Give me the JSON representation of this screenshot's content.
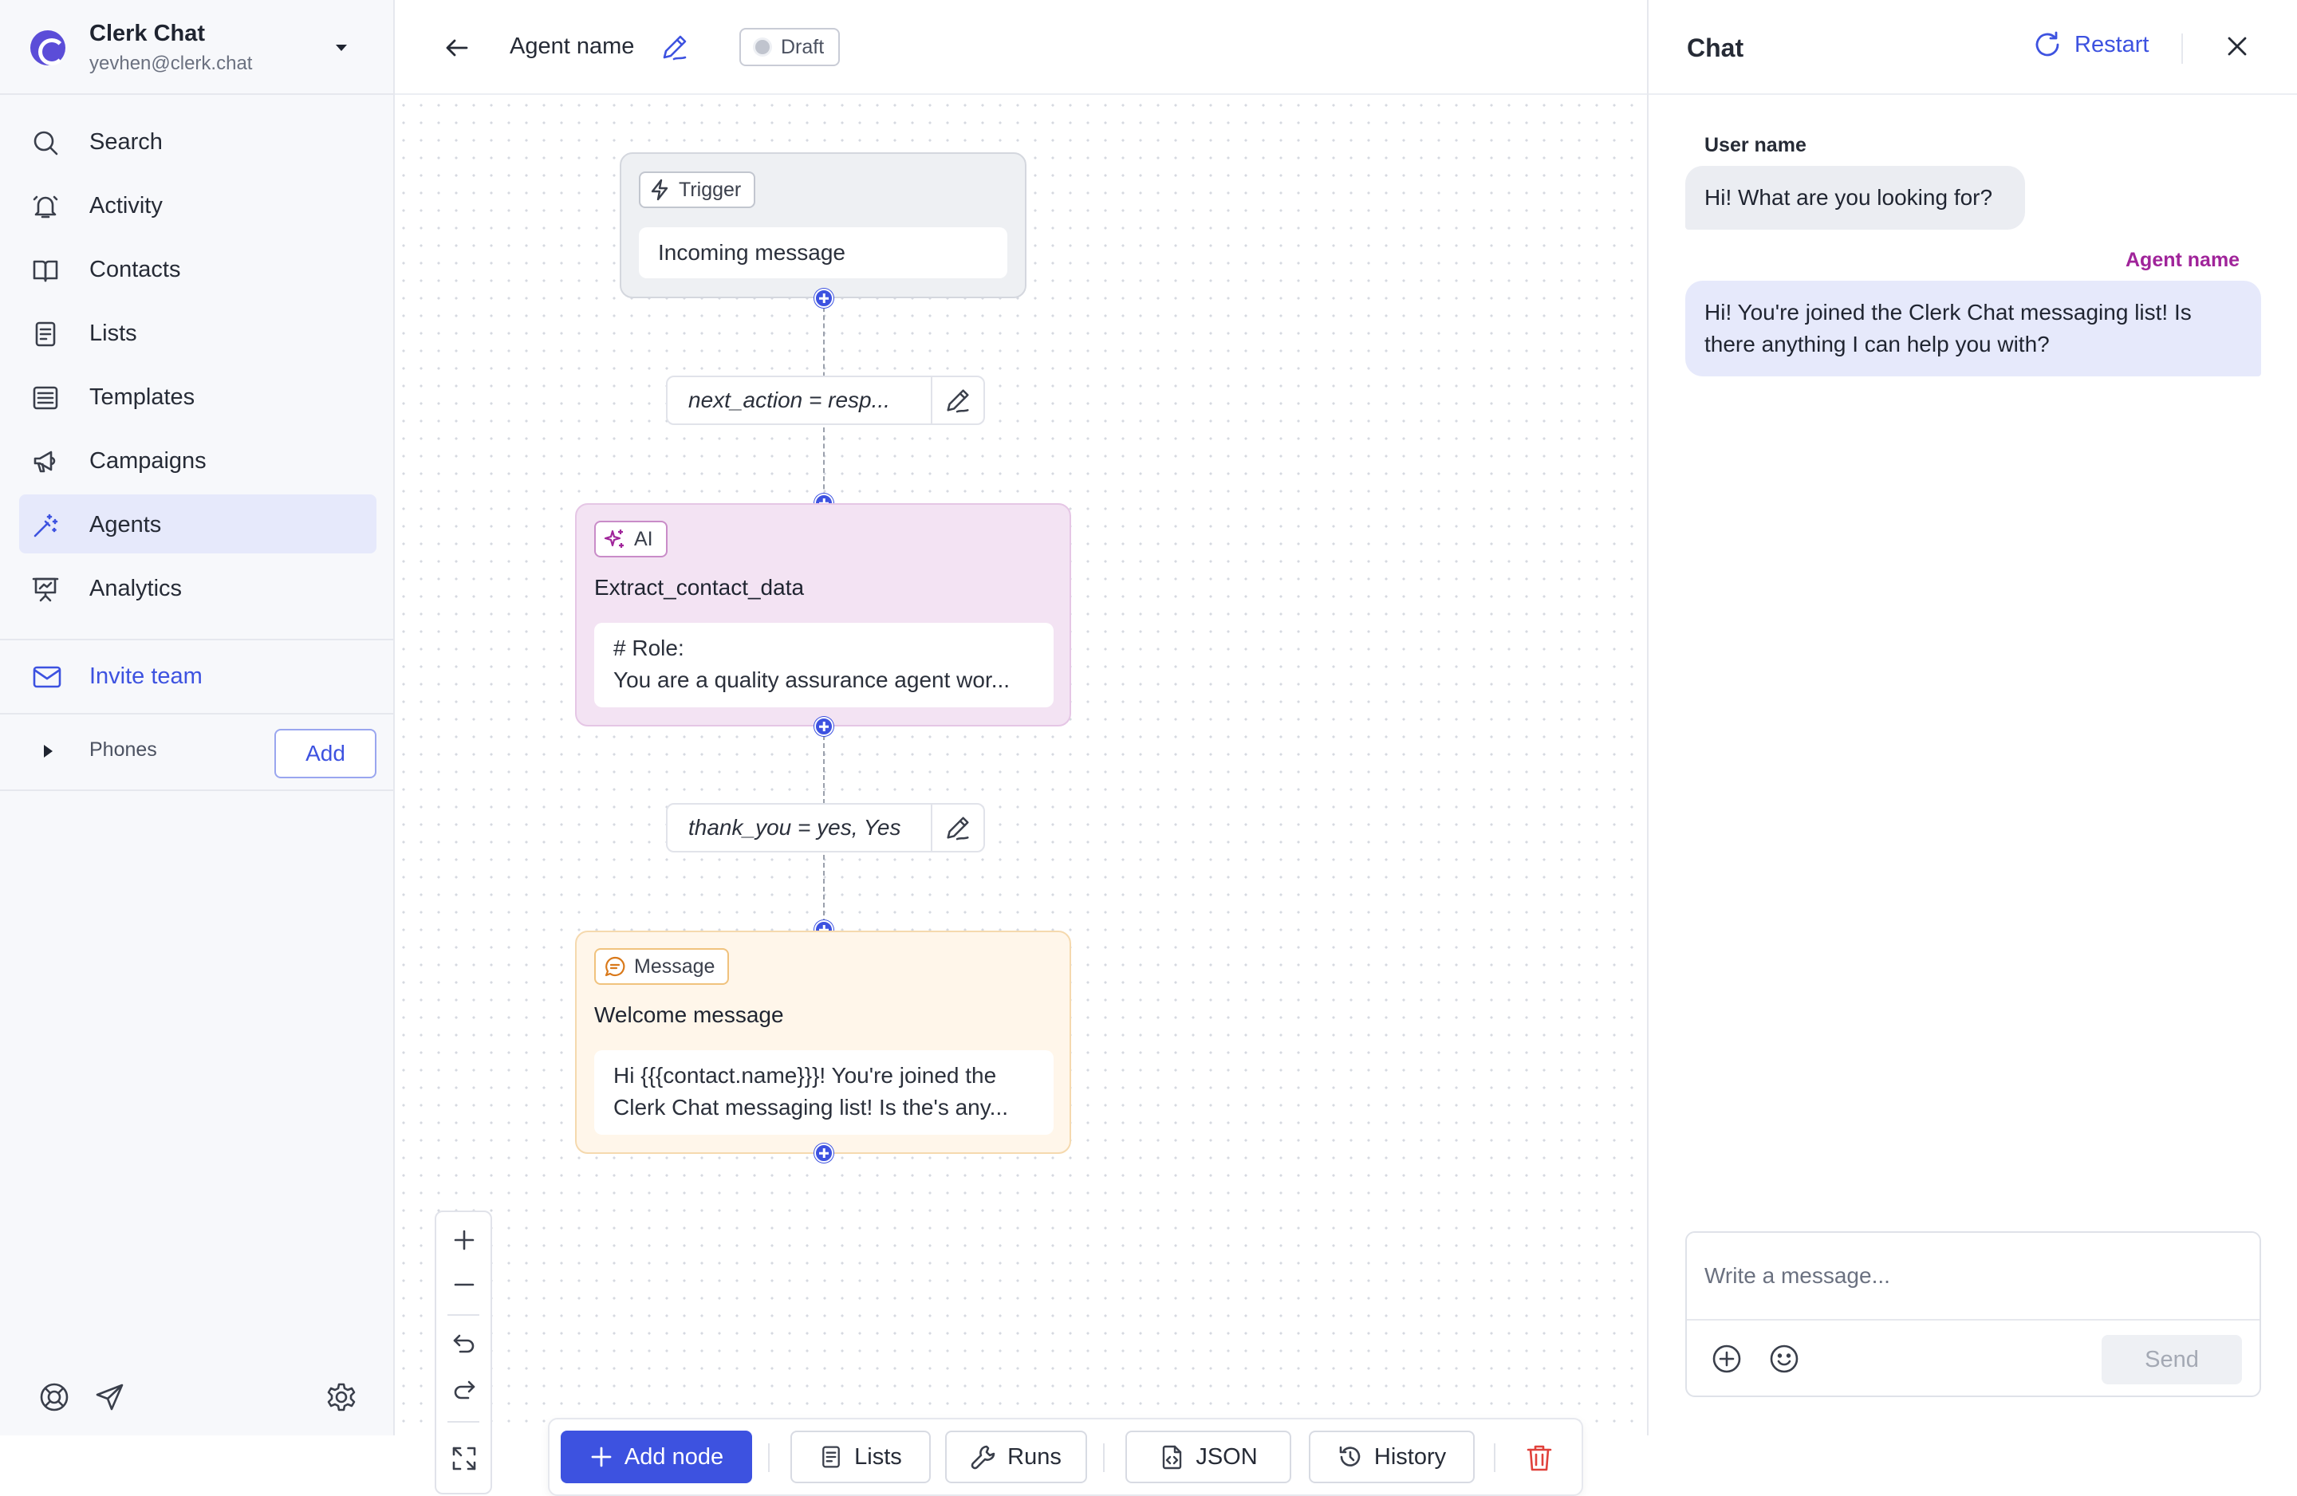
{
  "workspace": {
    "name": "Clerk Chat",
    "email": "yevhen@clerk.chat"
  },
  "nav": [
    {
      "label": "Search",
      "icon": "search-icon",
      "active": false
    },
    {
      "label": "Activity",
      "icon": "bell-icon",
      "active": false
    },
    {
      "label": "Contacts",
      "icon": "book-icon",
      "active": false
    },
    {
      "label": "Lists",
      "icon": "document-icon",
      "active": false
    },
    {
      "label": "Templates",
      "icon": "template-icon",
      "active": false
    },
    {
      "label": "Campaigns",
      "icon": "megaphone-icon",
      "active": false
    },
    {
      "label": "Agents",
      "icon": "magic-wand-icon",
      "active": true
    },
    {
      "label": "Analytics",
      "icon": "presentation-chart-icon",
      "active": false
    }
  ],
  "invite": {
    "label": "Invite team"
  },
  "phones": {
    "label": "Phones",
    "add_label": "Add"
  },
  "header": {
    "agent_name": "Agent name",
    "status": "Draft"
  },
  "flow": {
    "trigger": {
      "badge": "Trigger",
      "body": "Incoming message"
    },
    "condition1": {
      "text": "next_action = resp..."
    },
    "ai": {
      "badge": "AI",
      "title": "Extract_contact_data",
      "line1": "# Role:",
      "line2": "You are a quality assurance agent wor..."
    },
    "condition2": {
      "text": "thank_you = yes, Yes"
    },
    "message": {
      "badge": "Message",
      "title": "Welcome message",
      "line1": "Hi {{{contact.name}}}! You're joined the",
      "line2": "Clerk Chat messaging list! Is the's any..."
    }
  },
  "toolbar": {
    "add_node": "Add node",
    "lists": "Lists",
    "runs": "Runs",
    "json": "JSON",
    "history": "History"
  },
  "chat": {
    "title": "Chat",
    "restart": "Restart",
    "messages": [
      {
        "sender": "User name",
        "text": "Hi! What are you looking for?"
      },
      {
        "sender": "Agent name",
        "line1": "Hi! You're joined the Clerk Chat messaging list! Is",
        "line2": "there anything I can help you with?"
      }
    ],
    "input_placeholder": "Write a message...",
    "send": "Send"
  },
  "colors": {
    "accent": "#3d52e0",
    "ai_node": "#f3e3f3",
    "message_node": "#fff6ea",
    "trigger_node": "#eef0f3",
    "agent_sender": "#a0249a",
    "danger": "#e0413b"
  }
}
